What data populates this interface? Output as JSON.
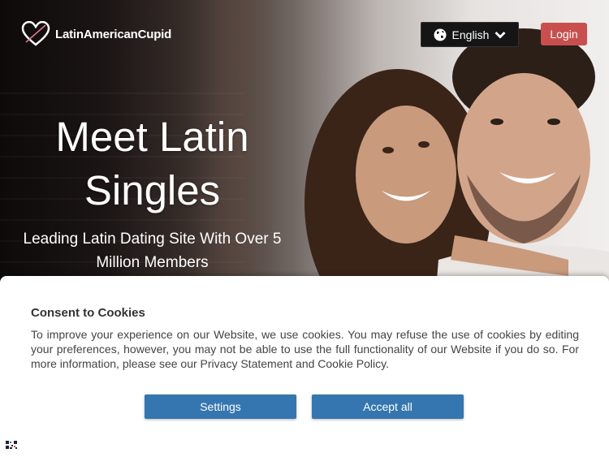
{
  "header": {
    "logo_text": "LatinAmericanCupid",
    "language_label": "English",
    "login_label": "Login"
  },
  "hero": {
    "headline_line1": "Meet Latin",
    "headline_line2": "Singles",
    "subline_line1": "Leading Latin Dating Site With Over 5",
    "subline_line2": "Million Members"
  },
  "cookie": {
    "title": "Consent to Cookies",
    "text": "To improve your experience on our Website, we use cookies. You may refuse the use of cookies by editing your preferences, however, you may not be able to use the full functionality of our Website if you do so. For more information, please see our Privacy Statement and Cookie Policy.",
    "settings_label": "Settings",
    "accept_label": "Accept all"
  },
  "colors": {
    "login": "#c94f4f",
    "cookie_button": "#3576b0",
    "language_bg": "#151515"
  }
}
